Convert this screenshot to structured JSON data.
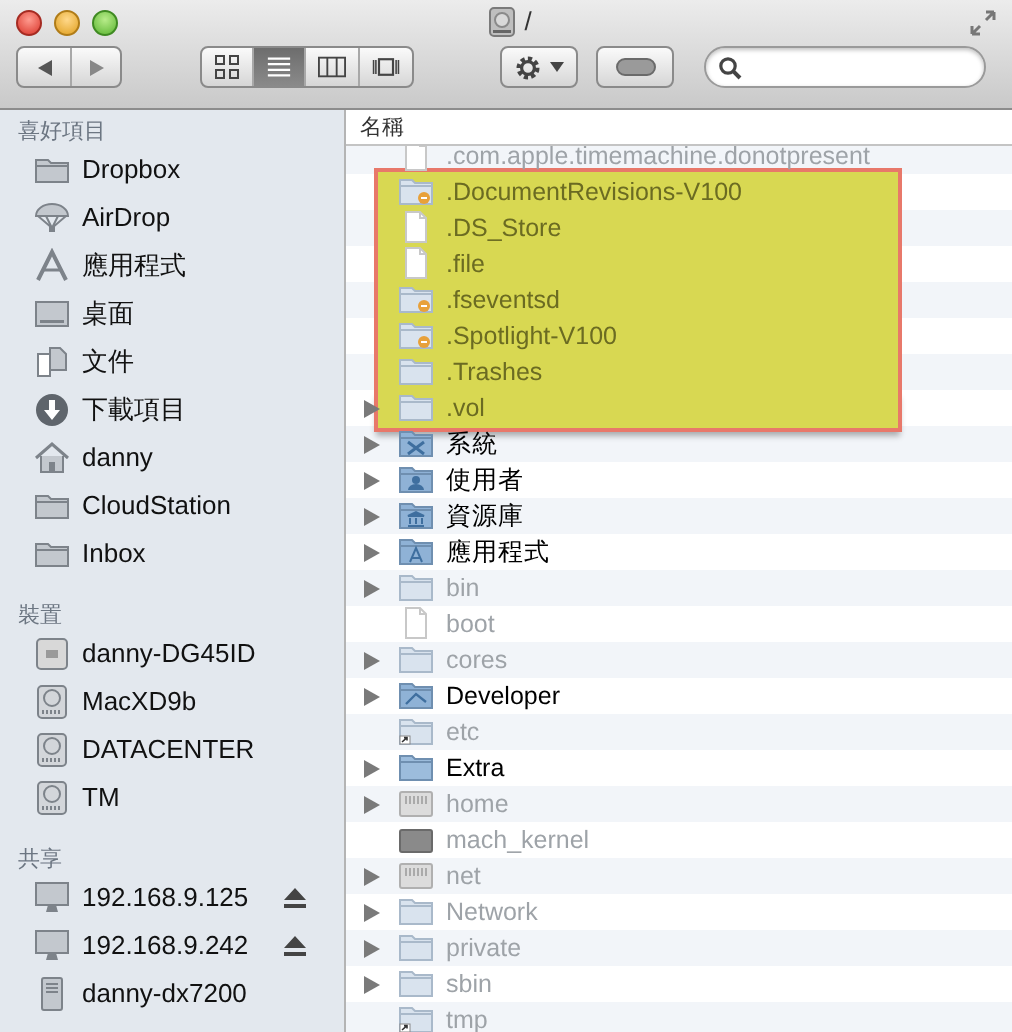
{
  "window": {
    "title": "/"
  },
  "toolbar": {
    "view_modes": [
      {
        "kind": "icons",
        "selected": false
      },
      {
        "kind": "list",
        "selected": true
      },
      {
        "kind": "columns",
        "selected": false
      },
      {
        "kind": "coverflow",
        "selected": false
      }
    ]
  },
  "sidebar": {
    "sections": [
      {
        "heading": "喜好項目",
        "items": [
          {
            "label": "Dropbox",
            "kind": "folder"
          },
          {
            "label": "AirDrop",
            "kind": "airdrop"
          },
          {
            "label": "應用程式",
            "kind": "apps"
          },
          {
            "label": "桌面",
            "kind": "desktop"
          },
          {
            "label": "文件",
            "kind": "documents"
          },
          {
            "label": "下載項目",
            "kind": "downloads"
          },
          {
            "label": "danny",
            "kind": "home"
          },
          {
            "label": "CloudStation",
            "kind": "folder"
          },
          {
            "label": "Inbox",
            "kind": "folder"
          }
        ]
      },
      {
        "heading": "裝置",
        "items": [
          {
            "label": "danny-DG45ID",
            "kind": "computer"
          },
          {
            "label": "MacXD9b",
            "kind": "drive"
          },
          {
            "label": "DATACENTER",
            "kind": "drive"
          },
          {
            "label": "TM",
            "kind": "drive"
          }
        ]
      },
      {
        "heading": "共享",
        "items": [
          {
            "label": "192.168.9.125",
            "kind": "display",
            "ejectable": true
          },
          {
            "label": "192.168.9.242",
            "kind": "display",
            "ejectable": true
          },
          {
            "label": "danny-dx7200",
            "kind": "pc",
            "ejectable": false
          }
        ]
      }
    ]
  },
  "file_list": {
    "column": "名稱",
    "rows": [
      {
        "name": ".com.apple.timemachine.donotpresent",
        "kind": "file",
        "expandable": false,
        "dimmed": true,
        "highlighted": false
      },
      {
        "name": ".DocumentRevisions-V100",
        "kind": "restricted",
        "expandable": false,
        "dimmed": true,
        "highlighted": true
      },
      {
        "name": ".DS_Store",
        "kind": "file",
        "expandable": false,
        "dimmed": true,
        "highlighted": true
      },
      {
        "name": ".file",
        "kind": "file",
        "expandable": false,
        "dimmed": true,
        "highlighted": true
      },
      {
        "name": ".fseventsd",
        "kind": "restricted",
        "expandable": false,
        "dimmed": true,
        "highlighted": true
      },
      {
        "name": ".Spotlight-V100",
        "kind": "restricted",
        "expandable": false,
        "dimmed": true,
        "highlighted": true
      },
      {
        "name": ".Trashes",
        "kind": "folder",
        "expandable": false,
        "dimmed": true,
        "highlighted": true
      },
      {
        "name": ".vol",
        "kind": "folder",
        "expandable": true,
        "dimmed": true,
        "highlighted": true
      },
      {
        "name": "系統",
        "kind": "system",
        "expandable": true,
        "dimmed": false,
        "highlighted": false
      },
      {
        "name": "使用者",
        "kind": "users",
        "expandable": true,
        "dimmed": false,
        "highlighted": false
      },
      {
        "name": "資源庫",
        "kind": "library",
        "expandable": true,
        "dimmed": false,
        "highlighted": false
      },
      {
        "name": "應用程式",
        "kind": "apps",
        "expandable": true,
        "dimmed": false,
        "highlighted": false
      },
      {
        "name": "bin",
        "kind": "folder",
        "expandable": true,
        "dimmed": true,
        "highlighted": false
      },
      {
        "name": "boot",
        "kind": "file",
        "expandable": false,
        "dimmed": true,
        "highlighted": false
      },
      {
        "name": "cores",
        "kind": "folder",
        "expandable": true,
        "dimmed": true,
        "highlighted": false
      },
      {
        "name": "Developer",
        "kind": "developer",
        "expandable": true,
        "dimmed": false,
        "highlighted": false
      },
      {
        "name": "etc",
        "kind": "alias",
        "expandable": false,
        "dimmed": true,
        "highlighted": false
      },
      {
        "name": "Extra",
        "kind": "folder",
        "expandable": true,
        "dimmed": false,
        "highlighted": false
      },
      {
        "name": "home",
        "kind": "network",
        "expandable": true,
        "dimmed": true,
        "highlighted": false
      },
      {
        "name": "mach_kernel",
        "kind": "binary",
        "expandable": false,
        "dimmed": true,
        "highlighted": false
      },
      {
        "name": "net",
        "kind": "network",
        "expandable": true,
        "dimmed": true,
        "highlighted": false
      },
      {
        "name": "Network",
        "kind": "folder",
        "expandable": true,
        "dimmed": true,
        "highlighted": false
      },
      {
        "name": "private",
        "kind": "folder",
        "expandable": true,
        "dimmed": true,
        "highlighted": false
      },
      {
        "name": "sbin",
        "kind": "folder",
        "expandable": true,
        "dimmed": true,
        "highlighted": false
      },
      {
        "name": "tmp",
        "kind": "alias",
        "expandable": false,
        "dimmed": true,
        "highlighted": false
      }
    ]
  }
}
